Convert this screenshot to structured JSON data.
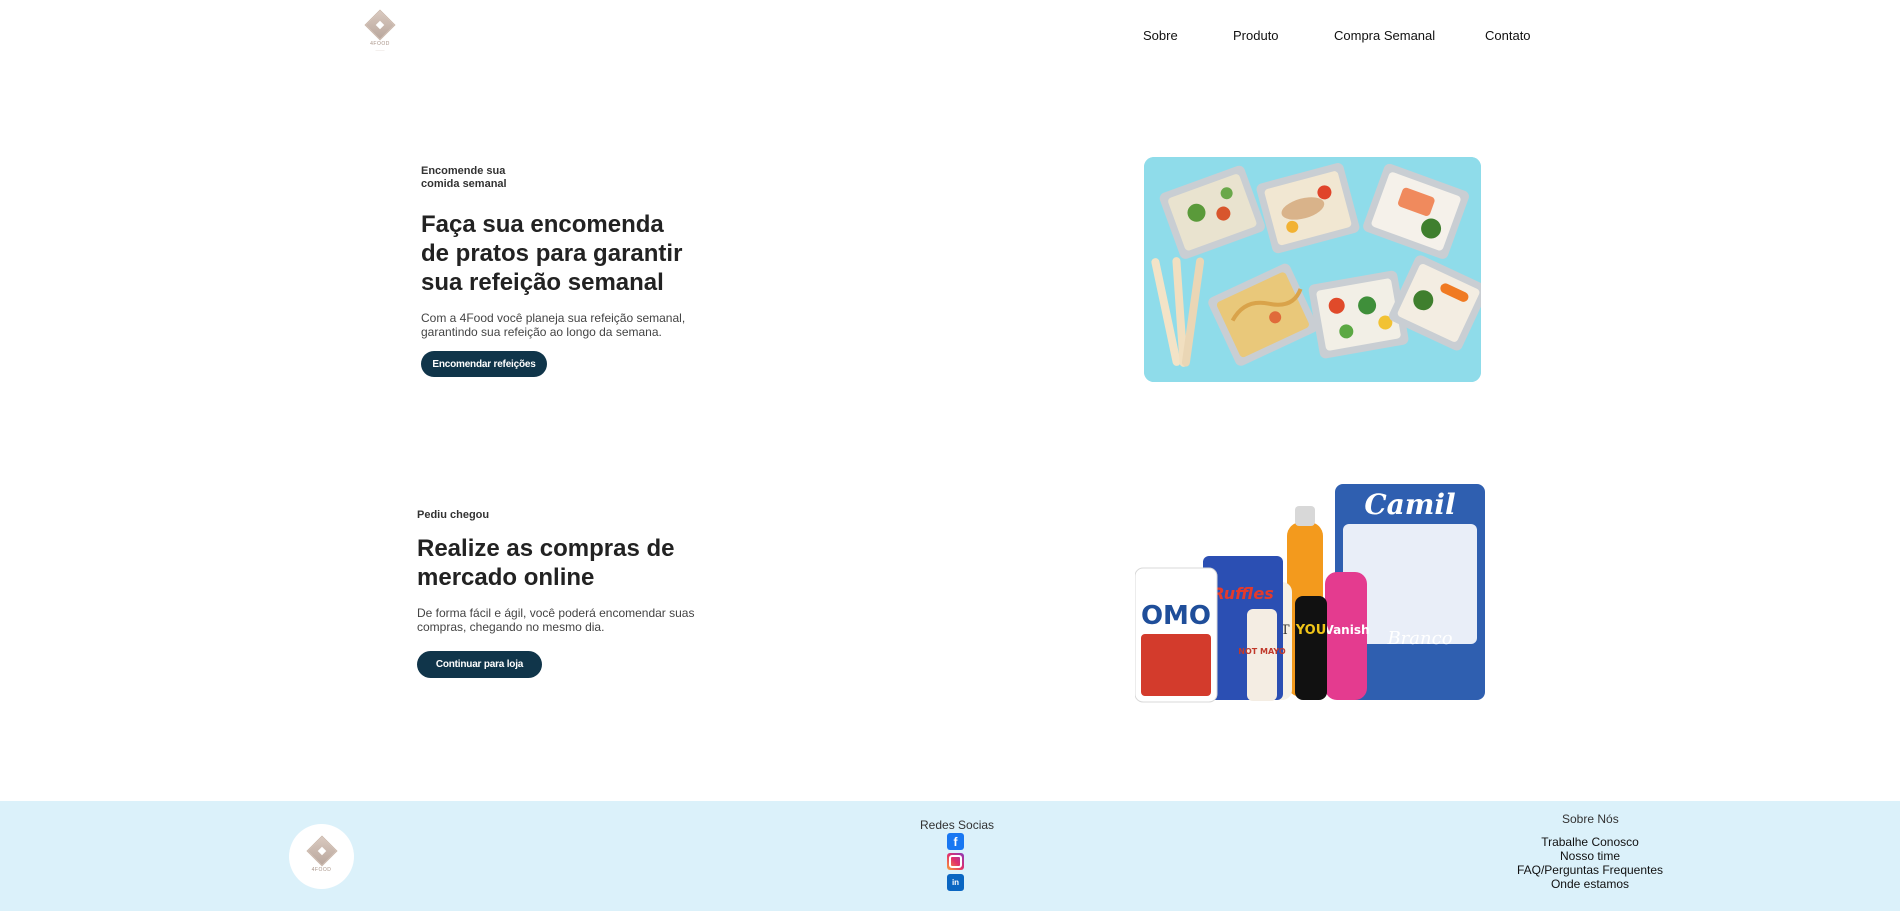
{
  "header": {
    "logo_alt": "4FOOD",
    "nav": [
      "Sobre",
      "Produto",
      "Compra Semanal",
      "Contato"
    ]
  },
  "hero": {
    "eyebrow": "Encomende sua comida semanal",
    "headline_lines": [
      "Faça sua encomenda",
      "de pratos para garantir",
      "sua refeição semanal"
    ],
    "desc_lines": [
      "Com a 4Food você planeja sua refeição semanal,",
      "garantindo sua refeição ao longo da semana."
    ],
    "button": "Encomendar refeições",
    "image_icon": "meal-prep-photo"
  },
  "market": {
    "eyebrow": "Pediu chegou",
    "headline_lines": [
      "Realize as compras de",
      "mercado online"
    ],
    "desc_lines": [
      "De forma fácil e ágil, você poderá encomendar suas",
      "compras, chegando no mesmo dia."
    ],
    "button": "Continuar para loja",
    "image_icon": "grocery-products-photo",
    "product_labels": [
      "OMO",
      "Ruffles",
      "NOT MAYO",
      "MIT",
      "YOU",
      "Vanish",
      "Camil",
      "Branco"
    ]
  },
  "footer": {
    "social_title": "Redes Socias",
    "social_icons": [
      "facebook-icon",
      "instagram-icon",
      "linkedin-icon"
    ],
    "about_title": "Sobre Nós",
    "about_links": [
      "Trabalhe Conosco",
      "Nosso time",
      "FAQ/Perguntas Frequentes",
      "Onde estamos"
    ]
  },
  "colors": {
    "button_bg": "#10354a",
    "footer_bg": "#dbf1fa",
    "food_bg": "#8fdcea"
  }
}
